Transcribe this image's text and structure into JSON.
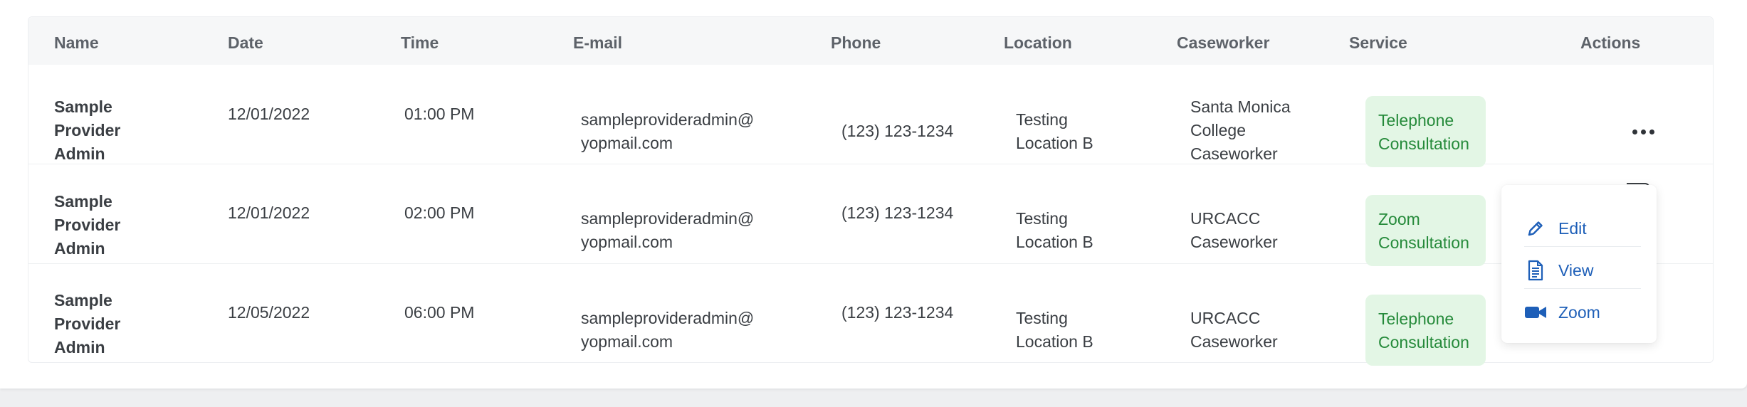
{
  "table": {
    "columns": [
      "Name",
      "Date",
      "Time",
      "E-mail",
      "Phone",
      "Location",
      "Caseworker",
      "Service",
      "Actions"
    ],
    "rows": [
      {
        "name": [
          "Sample",
          "Provider",
          "Admin"
        ],
        "date": "12/01/2022",
        "time": "01:00 PM",
        "email": [
          "sampleprovideradmin@",
          "yopmail.com"
        ],
        "phone": "(123) 123-1234",
        "location": [
          "Testing",
          "Location B"
        ],
        "caseworker": [
          "Santa Monica",
          "College",
          "Caseworker"
        ],
        "service": [
          "Telephone",
          "Consultation"
        ]
      },
      {
        "name": [
          "Sample",
          "Provider",
          "Admin"
        ],
        "date": "12/01/2022",
        "time": "02:00 PM",
        "email": [
          "sampleprovideradmin@",
          "yopmail.com"
        ],
        "phone": "(123) 123-1234",
        "location": [
          "Testing",
          "Location B"
        ],
        "caseworker": [
          "URCACC",
          "Caseworker"
        ],
        "service": [
          "Zoom",
          "Consultation"
        ]
      },
      {
        "name": [
          "Sample",
          "Provider",
          "Admin"
        ],
        "date": "12/05/2022",
        "time": "06:00 PM",
        "email": [
          "sampleprovideradmin@",
          "yopmail.com"
        ],
        "phone": "(123) 123-1234",
        "location": [
          "Testing",
          "Location B"
        ],
        "caseworker": [
          "URCACC",
          "Caseworker"
        ],
        "service": [
          "Telephone",
          "Consultation"
        ]
      }
    ]
  },
  "actions_menu": {
    "items": [
      {
        "label": "Edit",
        "icon": "pencil-icon"
      },
      {
        "label": "View",
        "icon": "document-icon"
      },
      {
        "label": "Zoom",
        "icon": "video-camera-icon"
      }
    ]
  },
  "colors": {
    "service_pill_bg": "#e3f6e5",
    "service_pill_text": "#258a3a",
    "menu_link": "#1e5fb8",
    "header_bg": "#f6f7f8"
  }
}
